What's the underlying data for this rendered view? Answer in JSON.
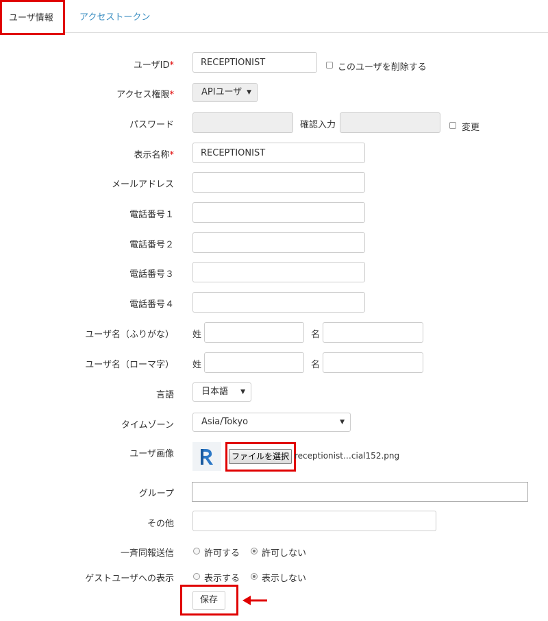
{
  "tabs": [
    {
      "label": "ユーザ情報",
      "active": true
    },
    {
      "label": "アクセストークン",
      "active": false
    }
  ],
  "form": {
    "user_id": {
      "label": "ユーザID",
      "required_mark": "*",
      "value": "RECEPTIONIST",
      "delete_label": "このユーザを削除する"
    },
    "access": {
      "label": "アクセス権限",
      "required_mark": "*",
      "value": "APIユーザ"
    },
    "password": {
      "label": "パスワード",
      "confirm_label": "確認入力",
      "change_label": "変更"
    },
    "display_name": {
      "label": "表示名称",
      "required_mark": "*",
      "value": "RECEPTIONIST"
    },
    "email": {
      "label": "メールアドレス",
      "value": ""
    },
    "phone1": {
      "label": "電話番号１",
      "value": ""
    },
    "phone2": {
      "label": "電話番号２",
      "value": ""
    },
    "phone3": {
      "label": "電話番号３",
      "value": ""
    },
    "phone4": {
      "label": "電話番号４",
      "value": ""
    },
    "kana": {
      "label": "ユーザ名（ふりがな）",
      "last_label": "姓",
      "first_label": "名"
    },
    "romaji": {
      "label": "ユーザ名（ローマ字）",
      "last_label": "姓",
      "first_label": "名"
    },
    "language": {
      "label": "言語",
      "value": "日本語"
    },
    "timezone": {
      "label": "タイムゾーン",
      "value": "Asia/Tokyo"
    },
    "image": {
      "label": "ユーザ画像",
      "button_label": "ファイルを選択",
      "file_name": "receptionist…cial152.png"
    },
    "group": {
      "label": "グループ",
      "value": ""
    },
    "other": {
      "label": "その他",
      "value": ""
    },
    "broadcast": {
      "label": "一斉同報送信",
      "options": [
        "許可する",
        "許可しない"
      ],
      "selected": "許可しない"
    },
    "guest": {
      "label": "ゲストユーザへの表示",
      "options": [
        "表示する",
        "表示しない"
      ],
      "selected": "表示しない"
    },
    "save_label": "保存"
  },
  "colors": {
    "highlight": "#e00000",
    "link": "#3b8ec2",
    "required": "#e00000"
  },
  "icons": {
    "caret": "▼",
    "arrow": "left-arrow-icon"
  }
}
